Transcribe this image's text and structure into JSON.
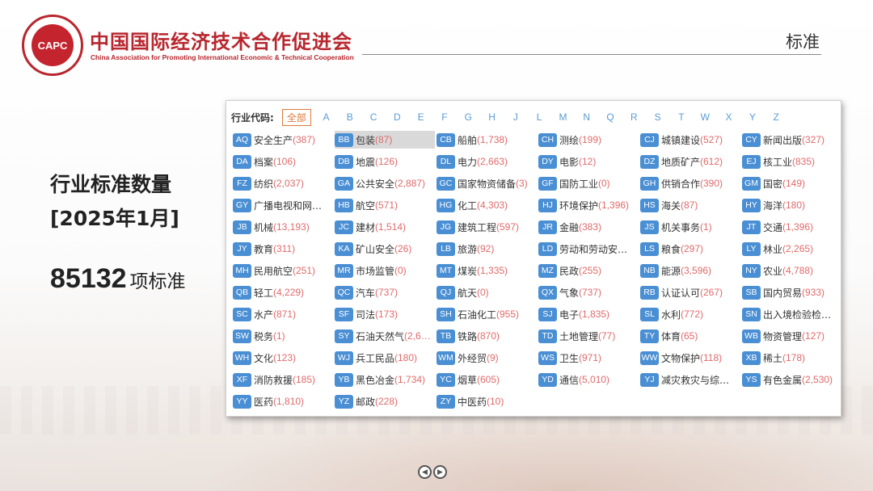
{
  "header": {
    "logo_text": "CAPC",
    "org_name_cn": "中国国际经济技术合作促进会",
    "org_name_en": "China Association for Promoting International Economic & Technical Cooperation",
    "section_title": "标准"
  },
  "summary": {
    "label_line1": "行业标准数量",
    "label_line2": "[2025年1月]",
    "count": "85132",
    "count_unit": "项标准"
  },
  "filter": {
    "label": "行业代码:",
    "all_label": "全部",
    "letters": [
      "A",
      "B",
      "C",
      "D",
      "E",
      "F",
      "G",
      "H",
      "J",
      "L",
      "M",
      "N",
      "Q",
      "R",
      "S",
      "T",
      "W",
      "X",
      "Y",
      "Z"
    ]
  },
  "industries": [
    {
      "code": "AQ",
      "name": "安全生产",
      "count": "(387)"
    },
    {
      "code": "BB",
      "name": "包装",
      "count": "(87)",
      "selected": true
    },
    {
      "code": "CB",
      "name": "船舶",
      "count": "(1,738)"
    },
    {
      "code": "CH",
      "name": "测绘",
      "count": "(199)"
    },
    {
      "code": "CJ",
      "name": "城镇建设",
      "count": "(527)"
    },
    {
      "code": "CY",
      "name": "新闻出版",
      "count": "(327)"
    },
    {
      "code": "DA",
      "name": "档案",
      "count": "(106)"
    },
    {
      "code": "DB",
      "name": "地震",
      "count": "(126)"
    },
    {
      "code": "DL",
      "name": "电力",
      "count": "(2,663)"
    },
    {
      "code": "DY",
      "name": "电影",
      "count": "(12)"
    },
    {
      "code": "DZ",
      "name": "地质矿产",
      "count": "(612)"
    },
    {
      "code": "EJ",
      "name": "核工业",
      "count": "(835)"
    },
    {
      "code": "FZ",
      "name": "纺织",
      "count": "(2,037)"
    },
    {
      "code": "GA",
      "name": "公共安全",
      "count": "(2,887)"
    },
    {
      "code": "GC",
      "name": "国家物资储备",
      "count": "(3)"
    },
    {
      "code": "GF",
      "name": "国防工业",
      "count": "(0)"
    },
    {
      "code": "GH",
      "name": "供销合作",
      "count": "(390)"
    },
    {
      "code": "GM",
      "name": "国密",
      "count": "(149)"
    },
    {
      "code": "GY",
      "name": "广播电视和网…",
      "count": ""
    },
    {
      "code": "HB",
      "name": "航空",
      "count": "(571)"
    },
    {
      "code": "HG",
      "name": "化工",
      "count": "(4,303)"
    },
    {
      "code": "HJ",
      "name": "环境保护",
      "count": "(1,396)"
    },
    {
      "code": "HS",
      "name": "海关",
      "count": "(87)"
    },
    {
      "code": "HY",
      "name": "海洋",
      "count": "(180)"
    },
    {
      "code": "JB",
      "name": "机械",
      "count": "(13,193)"
    },
    {
      "code": "JC",
      "name": "建材",
      "count": "(1,514)"
    },
    {
      "code": "JG",
      "name": "建筑工程",
      "count": "(597)"
    },
    {
      "code": "JR",
      "name": "金融",
      "count": "(383)"
    },
    {
      "code": "JS",
      "name": "机关事务",
      "count": "(1)"
    },
    {
      "code": "JT",
      "name": "交通",
      "count": "(1,396)"
    },
    {
      "code": "JY",
      "name": "教育",
      "count": "(311)"
    },
    {
      "code": "KA",
      "name": "矿山安全",
      "count": "(26)"
    },
    {
      "code": "LB",
      "name": "旅游",
      "count": "(92)"
    },
    {
      "code": "LD",
      "name": "劳动和劳动安…",
      "count": ""
    },
    {
      "code": "LS",
      "name": "粮食",
      "count": "(297)"
    },
    {
      "code": "LY",
      "name": "林业",
      "count": "(2,265)"
    },
    {
      "code": "MH",
      "name": "民用航空",
      "count": "(251)"
    },
    {
      "code": "MR",
      "name": "市场监管",
      "count": "(0)"
    },
    {
      "code": "MT",
      "name": "煤炭",
      "count": "(1,335)"
    },
    {
      "code": "MZ",
      "name": "民政",
      "count": "(255)"
    },
    {
      "code": "NB",
      "name": "能源",
      "count": "(3,596)"
    },
    {
      "code": "NY",
      "name": "农业",
      "count": "(4,788)"
    },
    {
      "code": "QB",
      "name": "轻工",
      "count": "(4,229)"
    },
    {
      "code": "QC",
      "name": "汽车",
      "count": "(737)"
    },
    {
      "code": "QJ",
      "name": "航天",
      "count": "(0)"
    },
    {
      "code": "QX",
      "name": "气象",
      "count": "(737)"
    },
    {
      "code": "RB",
      "name": "认证认可",
      "count": "(267)"
    },
    {
      "code": "SB",
      "name": "国内贸易",
      "count": "(933)"
    },
    {
      "code": "SC",
      "name": "水产",
      "count": "(871)"
    },
    {
      "code": "SF",
      "name": "司法",
      "count": "(173)"
    },
    {
      "code": "SH",
      "name": "石油化工",
      "count": "(955)"
    },
    {
      "code": "SJ",
      "name": "电子",
      "count": "(1,835)"
    },
    {
      "code": "SL",
      "name": "水利",
      "count": "(772)"
    },
    {
      "code": "SN",
      "name": "出入境检验检…",
      "count": ""
    },
    {
      "code": "SW",
      "name": "税务",
      "count": "(1)"
    },
    {
      "code": "SY",
      "name": "石油天然气",
      "count": "(2,6…"
    },
    {
      "code": "TB",
      "name": "铁路",
      "count": "(870)"
    },
    {
      "code": "TD",
      "name": "土地管理",
      "count": "(77)"
    },
    {
      "code": "TY",
      "name": "体育",
      "count": "(65)"
    },
    {
      "code": "WB",
      "name": "物资管理",
      "count": "(127)"
    },
    {
      "code": "WH",
      "name": "文化",
      "count": "(123)"
    },
    {
      "code": "WJ",
      "name": "兵工民品",
      "count": "(180)"
    },
    {
      "code": "WM",
      "name": "外经贸",
      "count": "(9)"
    },
    {
      "code": "WS",
      "name": "卫生",
      "count": "(971)"
    },
    {
      "code": "WW",
      "name": "文物保护",
      "count": "(118)"
    },
    {
      "code": "XB",
      "name": "稀土",
      "count": "(178)"
    },
    {
      "code": "XF",
      "name": "消防救援",
      "count": "(185)"
    },
    {
      "code": "YB",
      "name": "黑色冶金",
      "count": "(1,734)"
    },
    {
      "code": "YC",
      "name": "烟草",
      "count": "(605)"
    },
    {
      "code": "YD",
      "name": "通信",
      "count": "(5,010)"
    },
    {
      "code": "YJ",
      "name": "减灾救灾与综…",
      "count": ""
    },
    {
      "code": "YS",
      "name": "有色金属",
      "count": "(2,530)"
    },
    {
      "code": "YY",
      "name": "医药",
      "count": "(1,810)"
    },
    {
      "code": "YZ",
      "name": "邮政",
      "count": "(228)"
    },
    {
      "code": "ZY",
      "name": "中医药",
      "count": "(10)"
    }
  ],
  "nav": {
    "prev_icon": "chevron-left-icon",
    "next_icon": "chevron-right-icon"
  }
}
